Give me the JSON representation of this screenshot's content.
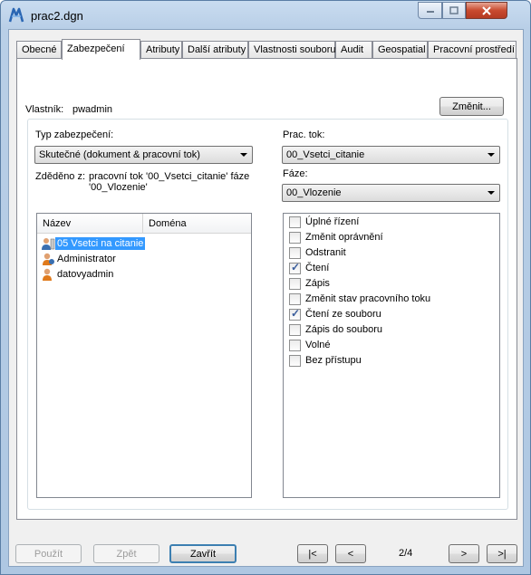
{
  "window": {
    "title": "prac2.dgn"
  },
  "tabs": [
    {
      "label": "Obecné"
    },
    {
      "label": "Zabezpečení"
    },
    {
      "label": "Atributy"
    },
    {
      "label": "Další atributy"
    },
    {
      "label": "Vlastnosti souboru"
    },
    {
      "label": "Audit"
    },
    {
      "label": "Geospatial"
    },
    {
      "label": "Pracovní prostředí"
    }
  ],
  "owner": {
    "label": "Vlastník:",
    "value": "pwadmin",
    "change_button": "Změnit..."
  },
  "security_type": {
    "label": "Typ zabezpečení:",
    "value": "Skutečné (dokument & pracovní tok)"
  },
  "inherited": {
    "label": "Zděděno z:",
    "value": "pracovní tok '00_Vsetci_citanie' fáze '00_Vlozenie'"
  },
  "workflow": {
    "label": "Prac. tok:",
    "value": "00_Vsetci_citanie"
  },
  "phase": {
    "label": "Fáze:",
    "value": "00_Vlozenie"
  },
  "users_list": {
    "columns": [
      "Název",
      "Doména"
    ],
    "rows": [
      {
        "name": "05 Vsetci na citanie",
        "domain": "",
        "icon": "group-icon",
        "selected": true
      },
      {
        "name": "Administrator",
        "domain": "",
        "icon": "user-icon",
        "selected": false
      },
      {
        "name": "datovyadmin",
        "domain": "",
        "icon": "user-icon",
        "selected": false
      }
    ]
  },
  "permissions": [
    {
      "label": "Úplné řízení",
      "checked": false
    },
    {
      "label": "Změnit oprávnění",
      "checked": false
    },
    {
      "label": "Odstranit",
      "checked": false
    },
    {
      "label": "Čtení",
      "checked": true
    },
    {
      "label": "Zápis",
      "checked": false
    },
    {
      "label": "Změnit stav pracovního toku",
      "checked": false
    },
    {
      "label": "Čtení ze souboru",
      "checked": true
    },
    {
      "label": "Zápis do souboru",
      "checked": false
    },
    {
      "label": "Volné",
      "checked": false
    },
    {
      "label": "Bez přístupu",
      "checked": false
    }
  ],
  "footer": {
    "apply": "Použít",
    "back": "Zpět",
    "close": "Zavřít",
    "first": "|<",
    "prev": "<",
    "page": "2/4",
    "next": ">",
    "last": ">|"
  }
}
